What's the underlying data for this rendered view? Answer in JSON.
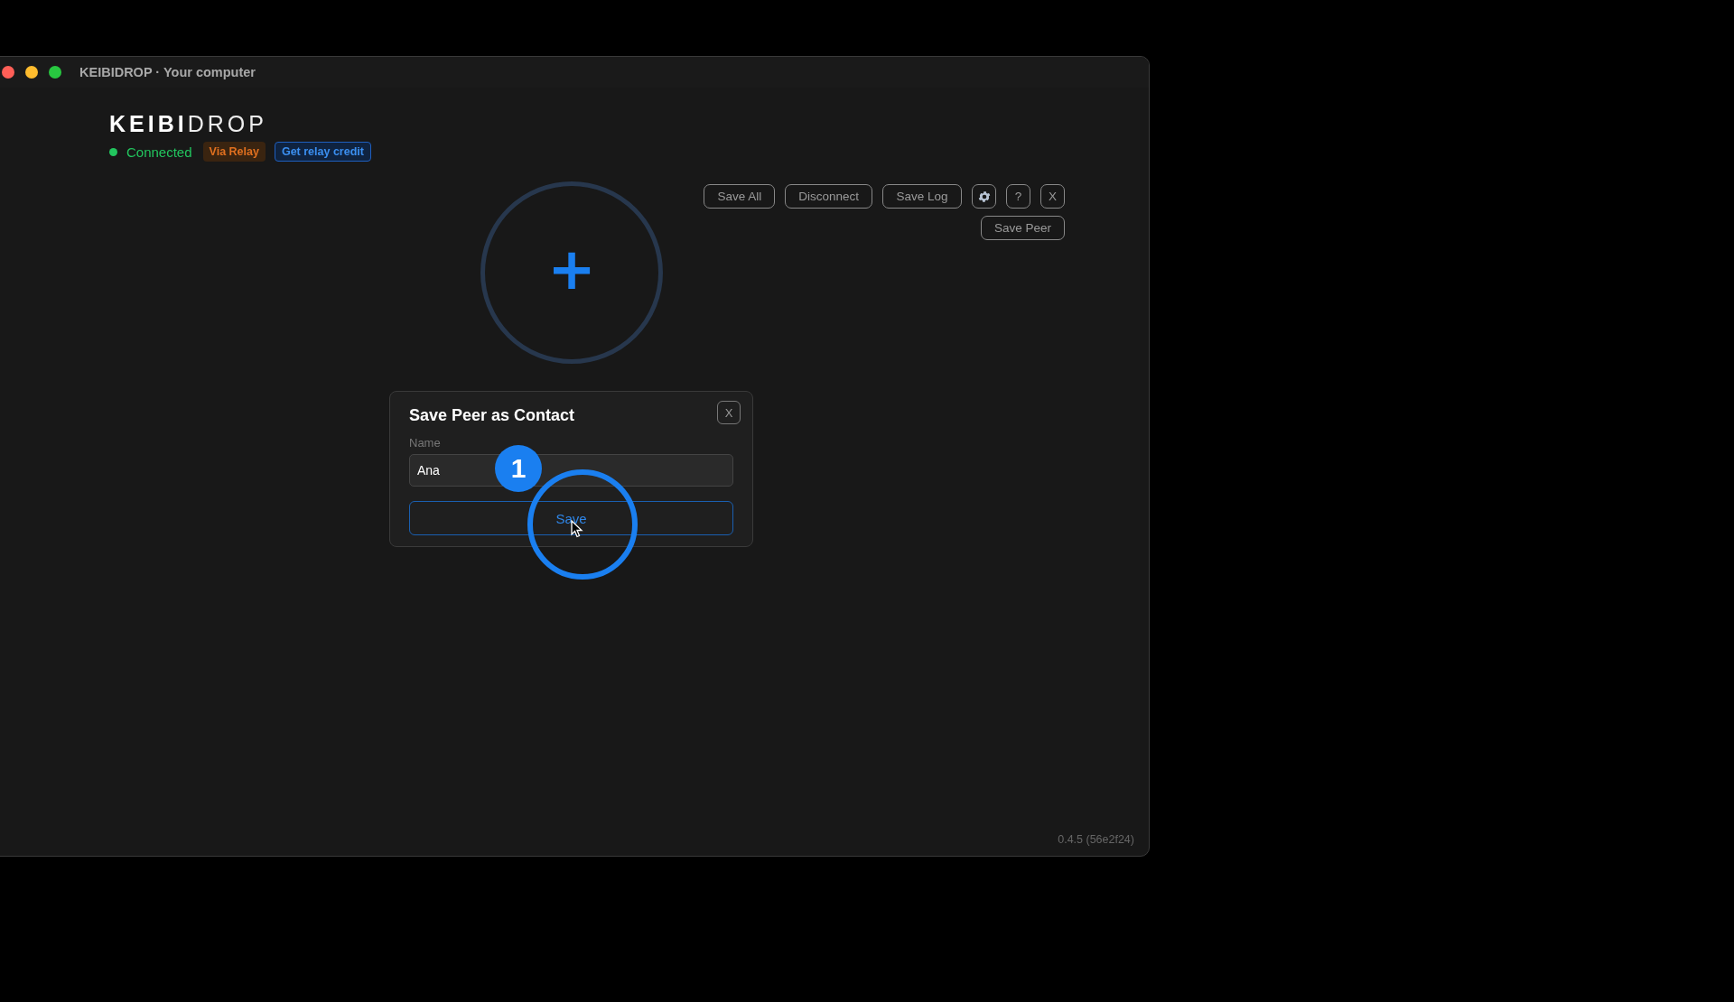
{
  "window": {
    "title": "KEIBIDROP · Your computer"
  },
  "logo": {
    "bold_part": "KEIBI",
    "light_part": "DROP"
  },
  "status": {
    "label": "Connected",
    "connected": true
  },
  "badges": [
    {
      "label": "Via Relay",
      "kind": "tag"
    },
    {
      "label": "Get relay credit",
      "kind": "link"
    }
  ],
  "toolbar": [
    {
      "kind": "text",
      "label": "Save All"
    },
    {
      "kind": "text",
      "label": "Disconnect"
    },
    {
      "kind": "text",
      "label": "Save Log"
    },
    {
      "kind": "icon"
    },
    {
      "kind": "text",
      "label": "?"
    },
    {
      "kind": "text",
      "label": "X"
    }
  ],
  "secondary_toolbar": [
    {
      "kind": "text",
      "label": "Save Peer"
    }
  ],
  "add_button": {
    "symbol": "+"
  },
  "dialog": {
    "title": "Save Peer as Contact",
    "close": "X",
    "field_label": "Name",
    "field_value": "Ana",
    "submit": "Save"
  },
  "tutorial_step": {
    "number": "1"
  },
  "version": "0.4.5 (56e2f24)"
}
